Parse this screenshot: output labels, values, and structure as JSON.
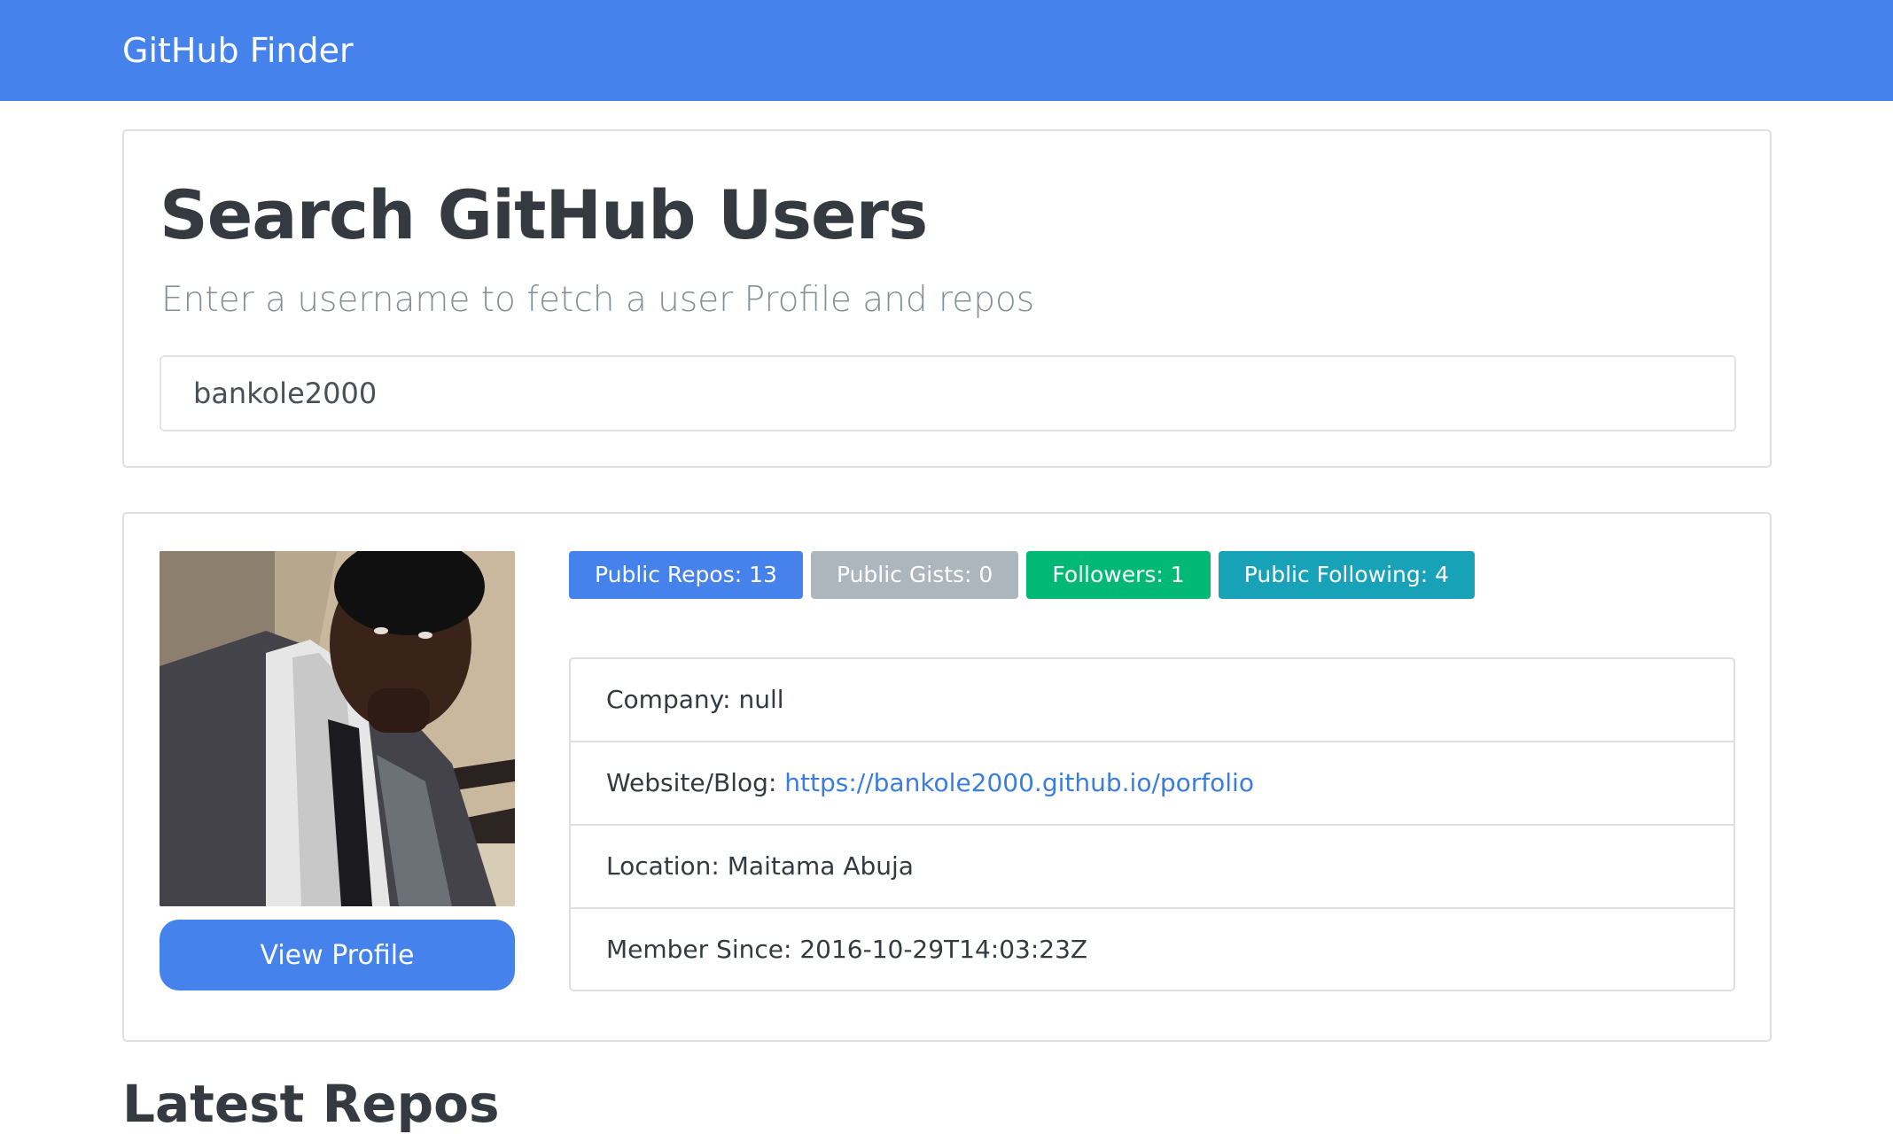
{
  "navbar": {
    "brand": "GitHub Finder"
  },
  "search": {
    "title": "Search GitHub Users",
    "lead": "Enter a username to fetch a user Profile and repos",
    "input_value": "bankole2000"
  },
  "profile": {
    "view_profile_label": "View Profile",
    "badges": [
      {
        "label": "Public Repos: 13",
        "color": "#4582ec"
      },
      {
        "label": "Public Gists: 0",
        "color": "#adb5bd"
      },
      {
        "label": "Followers: 1",
        "color": "#02b875"
      },
      {
        "label": "Public Following: 4",
        "color": "#17a2b8"
      }
    ],
    "details": {
      "company_label": "Company: null",
      "website_label": "Website/Blog: ",
      "website_link": "https://bankole2000.github.io/porfolio",
      "location_label": "Location: Maitama Abuja",
      "member_since_label": "Member Since: 2016-10-29T14:03:23Z"
    }
  },
  "repos": {
    "heading": "Latest Repos"
  },
  "colors": {
    "primary": "#4582ec",
    "secondary": "#adb5bd",
    "success": "#02b875",
    "info": "#17a2b8",
    "link": "#3b7ddd"
  }
}
